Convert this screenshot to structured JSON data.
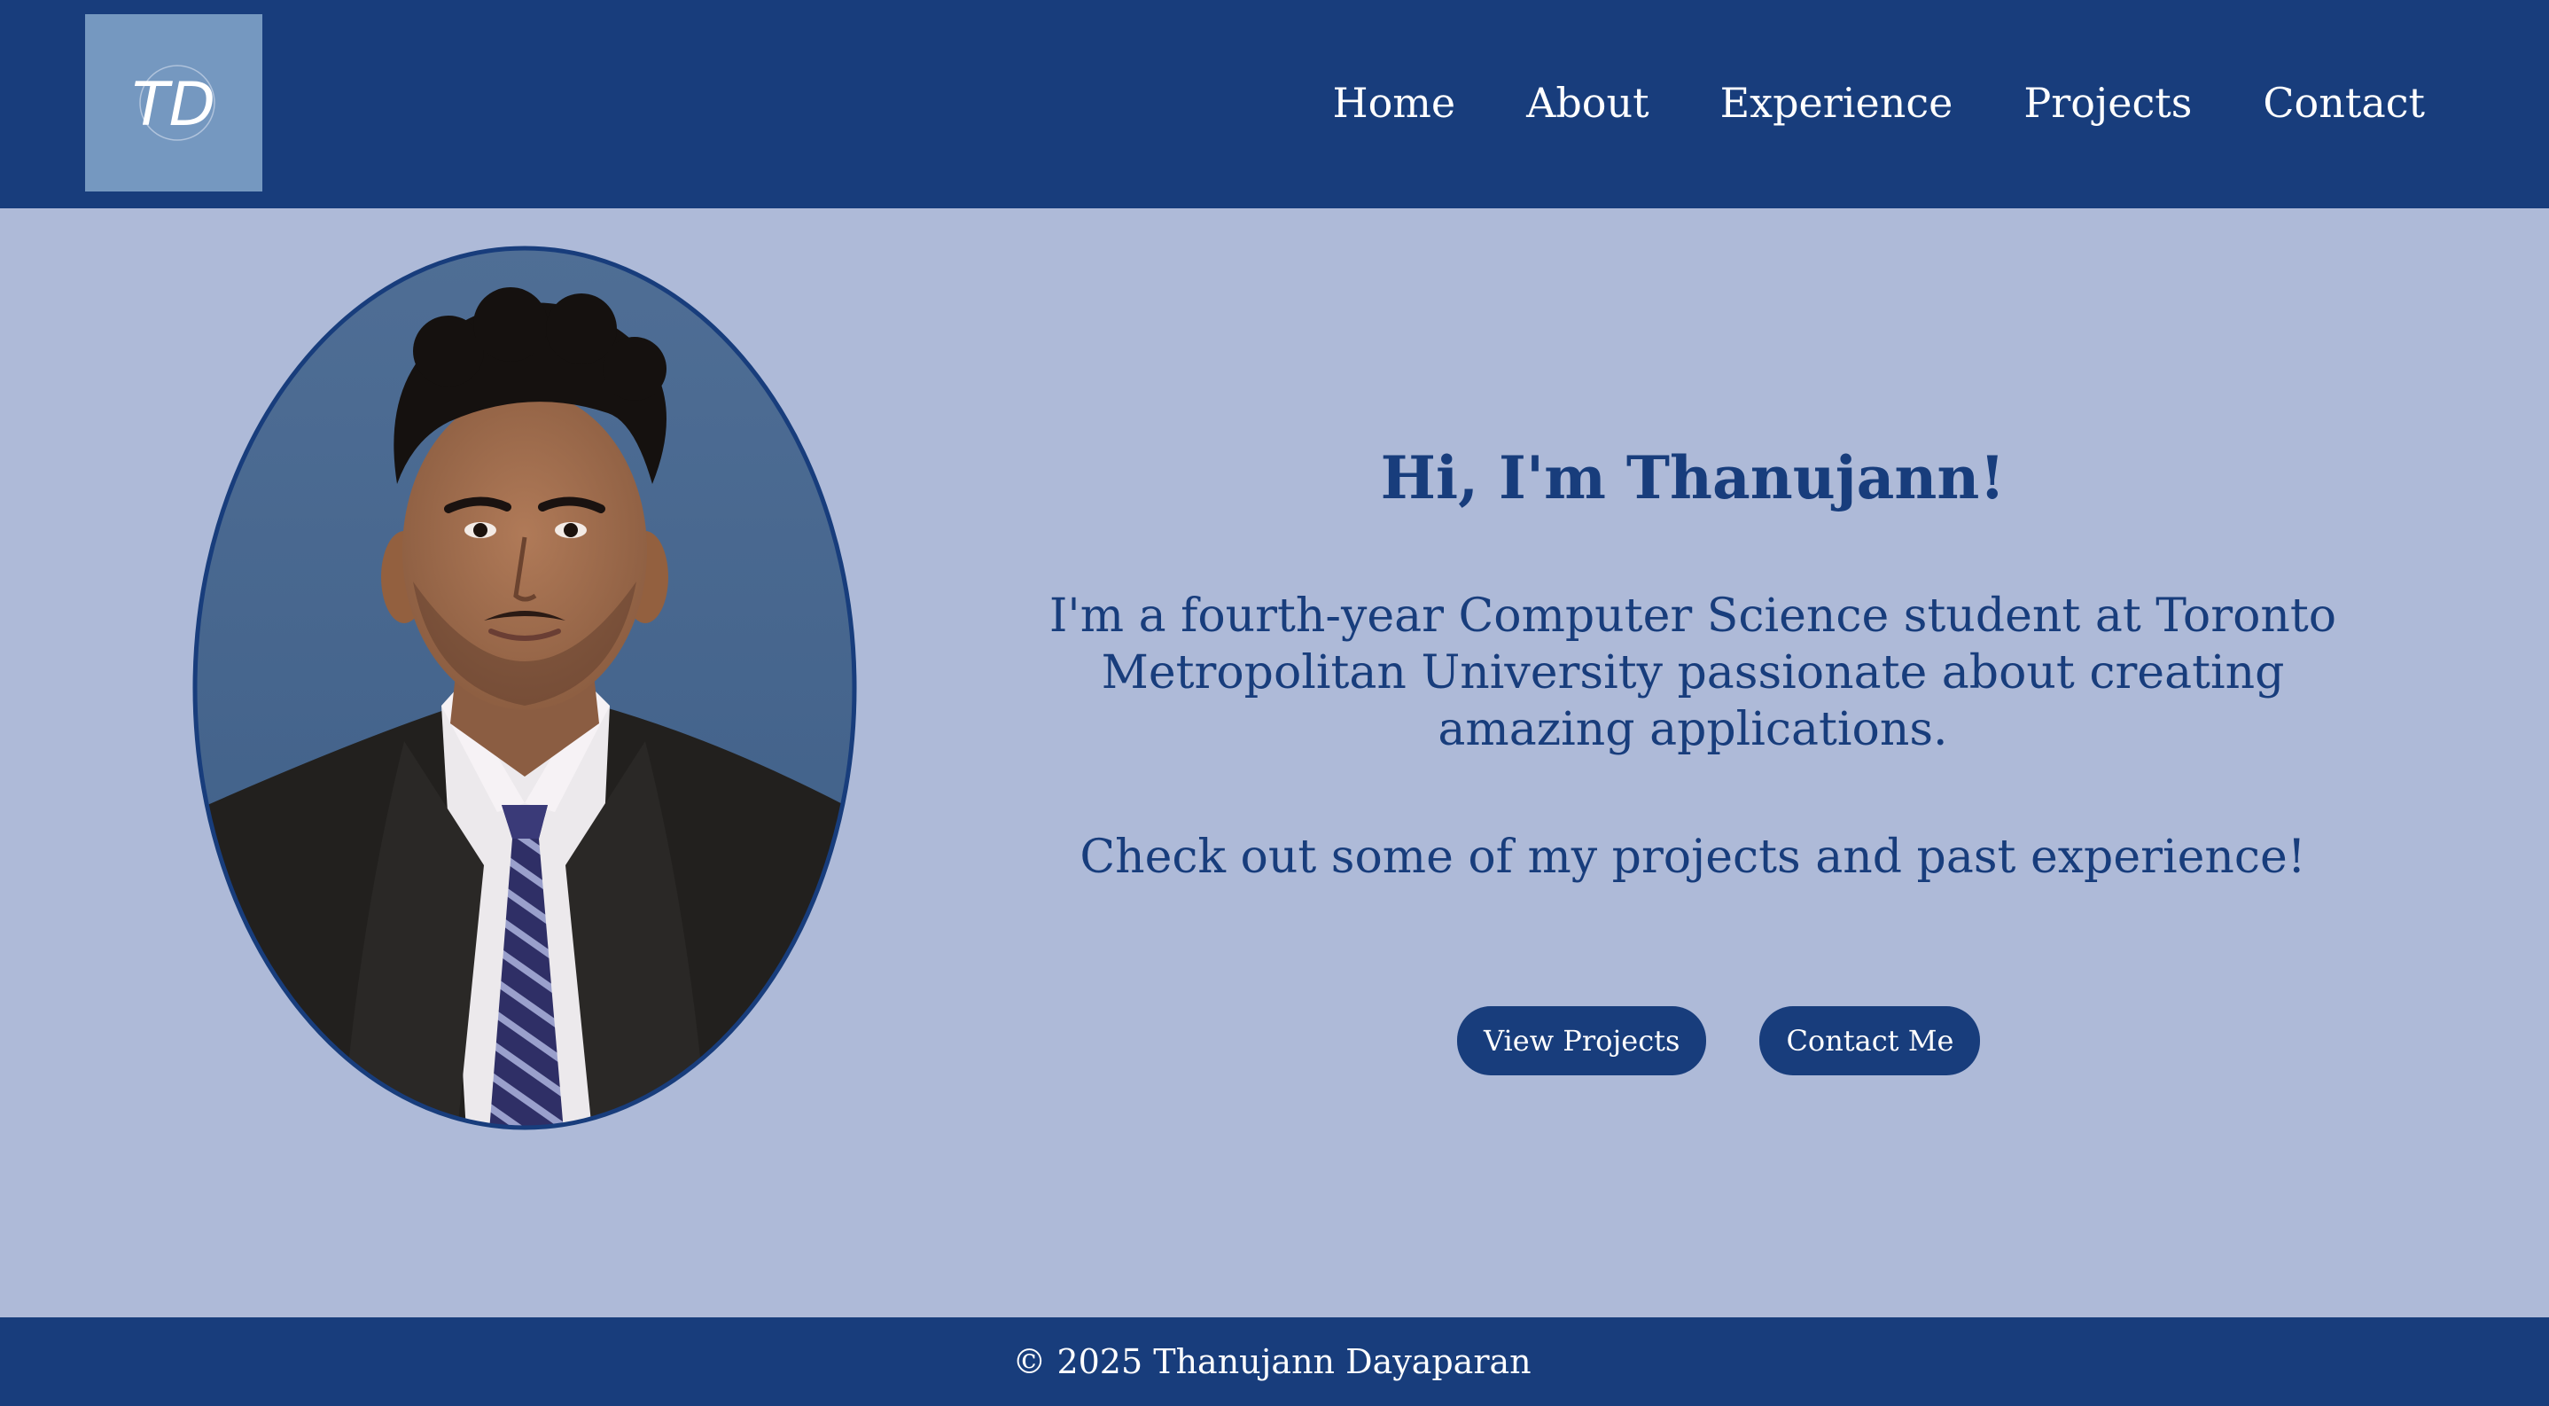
{
  "colors": {
    "primary": "#183d7c",
    "background": "#aebad8",
    "logo_bg": "#7598c0",
    "text_light": "#ffffff"
  },
  "header": {
    "logo": {
      "text": "TD",
      "icon": "td-monogram-logo"
    },
    "nav": [
      {
        "label": "Home"
      },
      {
        "label": "About"
      },
      {
        "label": "Experience"
      },
      {
        "label": "Projects"
      },
      {
        "label": "Contact"
      }
    ]
  },
  "hero": {
    "portrait_icon": "profile-photo",
    "title": "Hi, I'm Thanujann!",
    "bio": "I'm a fourth-year Computer Science student at Toronto Metropolitan University passionate about creating amazing applications.",
    "cta_text": "Check out some of my projects and past experience!",
    "buttons": {
      "primary": "View Projects",
      "secondary": "Contact Me"
    }
  },
  "footer": {
    "copyright": "© 2025 Thanujann Dayaparan"
  }
}
